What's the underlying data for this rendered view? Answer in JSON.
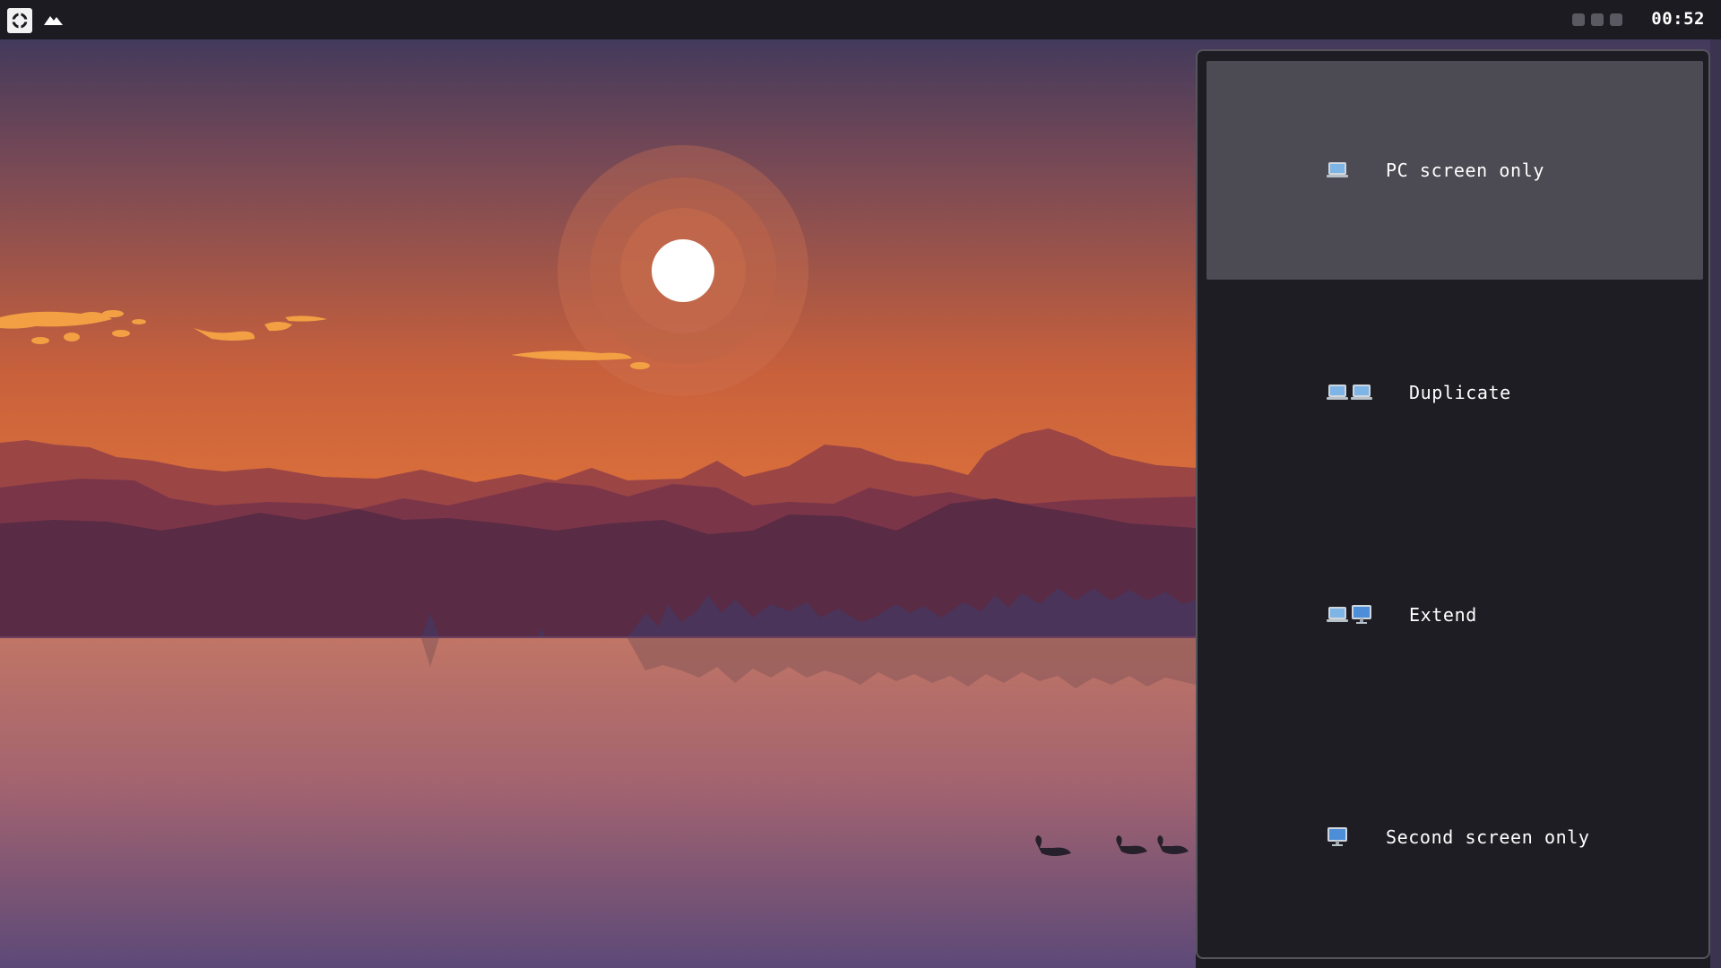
{
  "topbar": {
    "launcher_icon": "launcher-logo-icon",
    "app_icon": "mountain-icon",
    "workspaces": [
      {
        "id": 1,
        "icon": "workspace-dot-icon"
      },
      {
        "id": 2,
        "icon": "workspace-dot-icon"
      },
      {
        "id": 3,
        "icon": "workspace-dot-icon"
      }
    ],
    "clock": "00:52"
  },
  "projection_menu": {
    "options": [
      {
        "label": "PC screen only",
        "icons": [
          "laptop-icon"
        ],
        "selected": true
      },
      {
        "label": "Duplicate",
        "icons": [
          "laptop-icon",
          "laptop-icon"
        ],
        "selected": false
      },
      {
        "label": "Extend",
        "icons": [
          "laptop-icon",
          "monitor-icon"
        ],
        "selected": false
      },
      {
        "label": "Second screen only",
        "icons": [
          "monitor-icon"
        ],
        "selected": false
      }
    ]
  },
  "colors": {
    "bar_bg": "#1c1b22",
    "panel_bg": "#1e1d24",
    "selected_bg": "#4c4b53",
    "panel_border": "#56555d",
    "text": "#ffffff"
  }
}
